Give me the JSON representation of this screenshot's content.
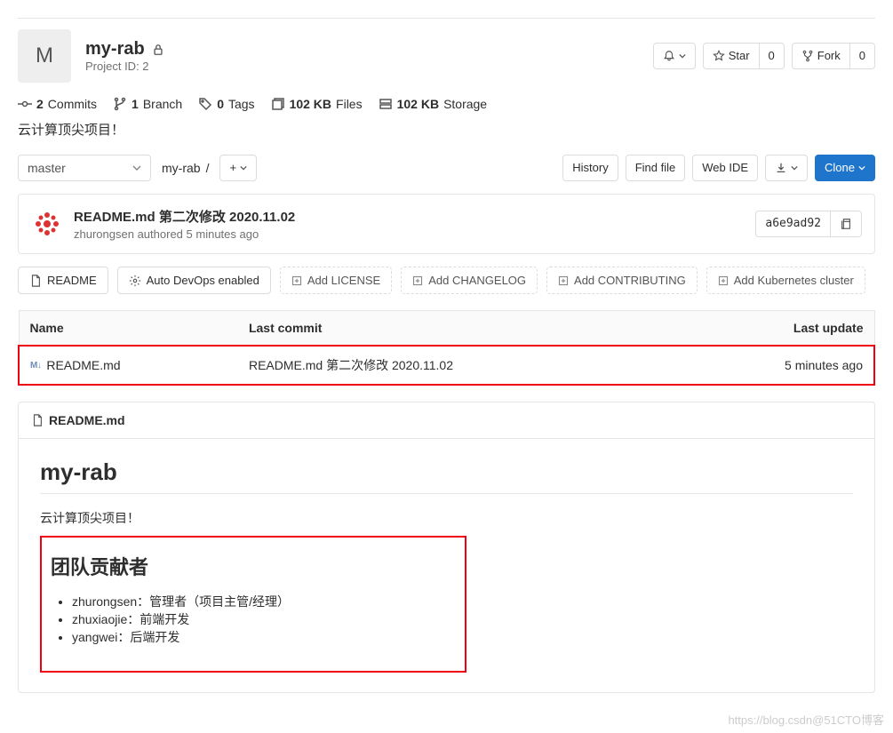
{
  "header": {
    "avatar_letter": "M",
    "title": "my-rab",
    "project_id_label": "Project ID: 2",
    "actions": {
      "star_label": "Star",
      "star_count": "0",
      "fork_label": "Fork",
      "fork_count": "0"
    }
  },
  "stats": {
    "commits_count": "2",
    "commits_label": "Commits",
    "branches_count": "1",
    "branches_label": "Branch",
    "tags_count": "0",
    "tags_label": "Tags",
    "files_size": "102 KB",
    "files_label": "Files",
    "storage_size": "102 KB",
    "storage_label": "Storage"
  },
  "description": "云计算顶尖项目！",
  "branch": {
    "selected": "master",
    "breadcrumb": "my-rab",
    "add_label": "+"
  },
  "buttons": {
    "history": "History",
    "find_file": "Find file",
    "web_ide": "Web IDE",
    "clone": "Clone"
  },
  "commit": {
    "title": "README.md 第二次修改 2020.11.02",
    "author": "zhurongsen",
    "authored_label": "authored",
    "time": "5 minutes ago",
    "sha": "a6e9ad92"
  },
  "pills": {
    "readme": "README",
    "auto_devops": "Auto DevOps enabled",
    "add_license": "Add LICENSE",
    "add_changelog": "Add CHANGELOG",
    "add_contributing": "Add CONTRIBUTING",
    "add_k8s": "Add Kubernetes cluster"
  },
  "table": {
    "cols": {
      "name": "Name",
      "last_commit": "Last commit",
      "last_update": "Last update"
    },
    "row": {
      "name": "README.md",
      "commit": "README.md 第二次修改 2020.11.02",
      "update": "5 minutes ago"
    }
  },
  "readme": {
    "header_label": "README.md",
    "h1": "my-rab",
    "p1": "云计算顶尖项目！",
    "h2": "团队贡献者",
    "li1": "zhurongsen：管理者（项目主管/经理）",
    "li2": "zhuxiaojie：前端开发",
    "li3": "yangwei：后端开发"
  },
  "watermark": "https://blog.csdn@51CTO博客"
}
